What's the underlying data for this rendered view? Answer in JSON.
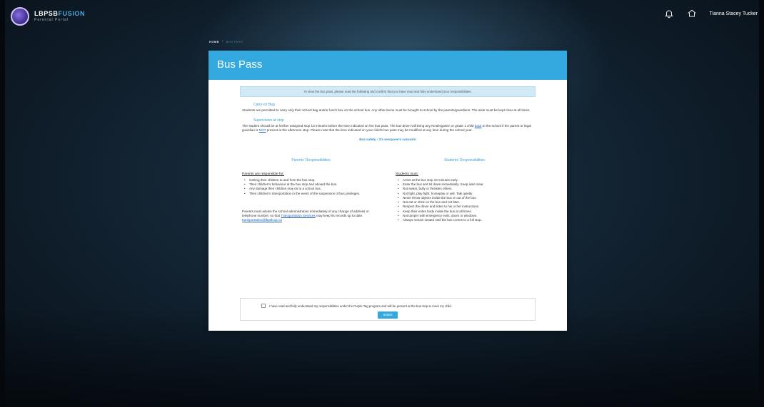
{
  "header": {
    "logo_title_a": "LBPSB",
    "logo_title_b": "FUSION",
    "logo_subtitle": "Parental Portal",
    "user_name": "Tianna Stacey Tucker"
  },
  "icons": {
    "notifications": "bell-icon",
    "home": "home-icon"
  },
  "breadcrumb": {
    "home": "HOME",
    "separator": "›",
    "current": "BUS PASS"
  },
  "panel": {
    "title": "Bus Pass",
    "info_banner": "To view the bus pass, please read the following and confirm that you have read and fully understand your responsibilities.",
    "carry_on": {
      "heading": "Carry-on Bag",
      "text": "Students are permitted to carry only their school bag and/or lunch box on the school bus. Any other items must be brought to school by the parents/guardians. The aisle must be kept clear at all times."
    },
    "supervision": {
      "heading": "Supervision at stop",
      "text_a": "The student should be at his/her assigned stop 10 minutes before the time indicated on the bus pass. The bus driver will bring any Kindergarten or grade 1 child ",
      "link_back": "back",
      "text_b": " to the school if the parent or legal guardian is ",
      "link_not": "NOT",
      "text_c": " present at the afternoon stop. Please note that the time indicated on your child's bus pass may be modified at any time during the school year."
    },
    "safety_line": "Bus safety - it's everyone's concern!",
    "parents": {
      "heading": "Parents' Responsibilities",
      "subheading": "Parents are responsible for:",
      "items": [
        "Getting their children to and from the bus stop.",
        "Their children's behaviour at the bus stop and aboard the bus.",
        "Any damage their children may do to a school bus.",
        "Their children's transportation in the event of the suspension of bus privileges."
      ],
      "advise_a": "Parents must advise the school administration immediately of any change of address or telephone number, so that ",
      "advise_link_1": "Transportation Services",
      "advise_b": " may keep its records up to date. ",
      "advise_link_2": "transportation@lbpsb.qc.ca"
    },
    "students": {
      "heading": "Students' Responsibilities",
      "subheading": "Students must:",
      "items": [
        "Arrive at the bus stop 10 minutes early.",
        "Enter the bus and sit down immediately. Keep aisle clear.",
        "Not swear, bully or threaten others.",
        "Not fight, play fight, horseplay or yell. Talk quietly.",
        "Never throw objects inside the bus or out of the bus.",
        "Not eat or drink on the bus and not litter.",
        "Respect the driver and listen to his or her instructions.",
        "Keep their entire body inside the bus at all times.",
        "Not tamper with emergency exits, doors or windows.",
        "Always remain seated until the bus comes to a full stop."
      ]
    },
    "confirm_label": "I have read and fully understand my responsibilities under the Purple Tag program and will be present at the bus stop to meet my child.",
    "submit_label": "Submit"
  },
  "colors": {
    "accent": "#33a9e0",
    "banner_bg": "#d2e9f6",
    "link": "#1a5dbf",
    "heading_blue": "#3b9fd6"
  }
}
